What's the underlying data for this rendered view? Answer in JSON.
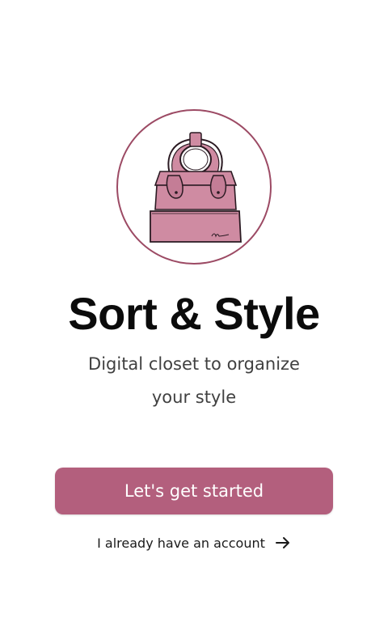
{
  "app": {
    "logo_icon": "handbag-icon",
    "brand_color": "#b35f7d",
    "logo_fill": "#cf8ba2",
    "logo_stroke": "#2a1a22"
  },
  "onboarding": {
    "title": "Sort & Style",
    "subtitle": "Digital closet to organize your style",
    "primary_button_label": "Let's get started",
    "secondary_link_label": "I already have an account",
    "secondary_link_icon": "arrow-right-icon"
  }
}
